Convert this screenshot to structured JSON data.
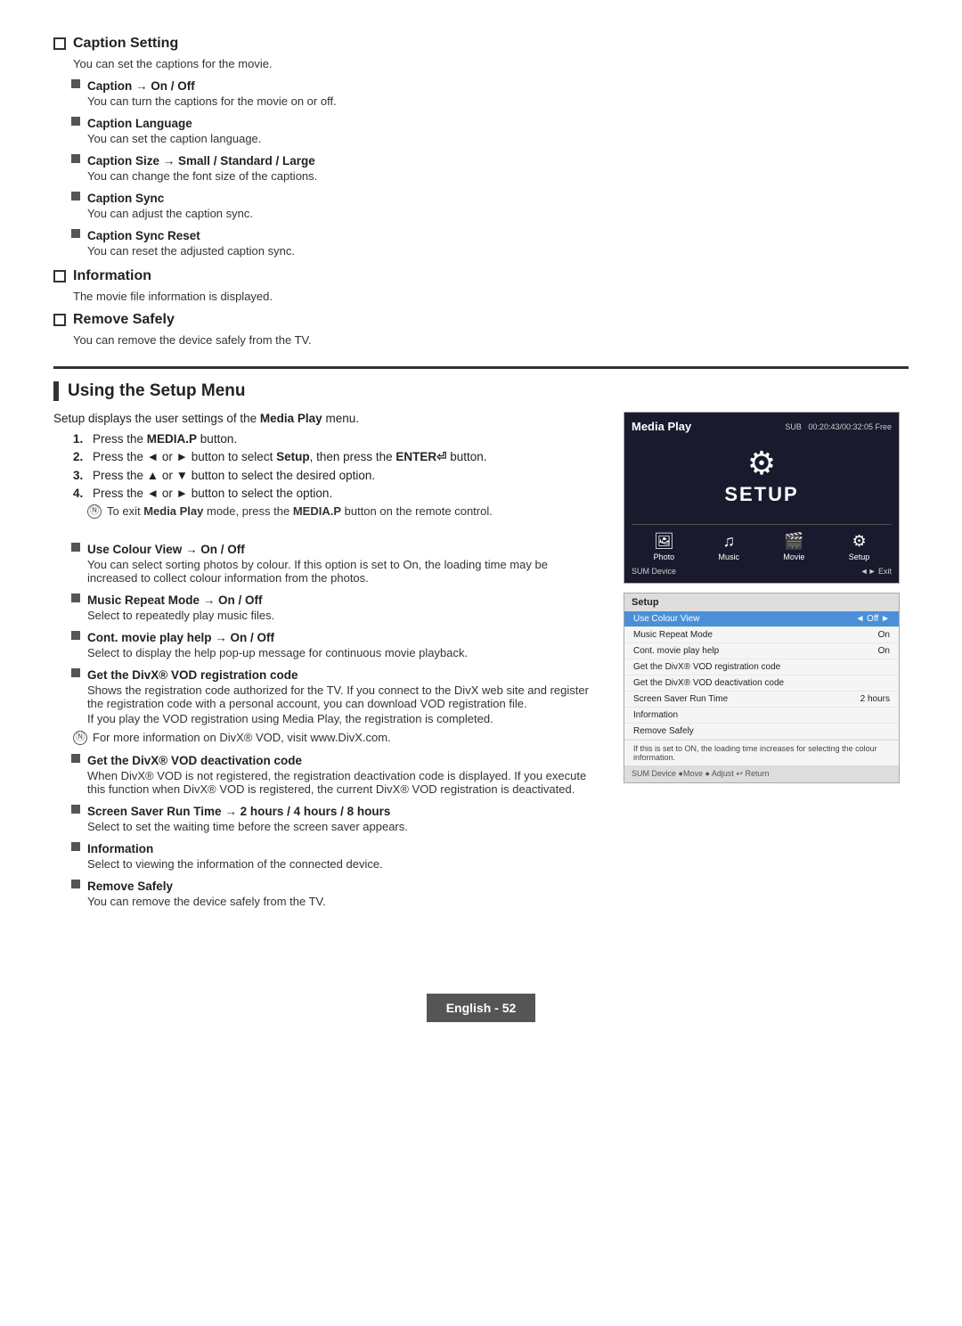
{
  "page": {
    "footer_label": "English - 52"
  },
  "caption_setting": {
    "heading": "Caption Setting",
    "description": "You can set the captions for the movie.",
    "items": [
      {
        "label": "Caption → On / Off",
        "description": "You can turn the captions for the movie on or off."
      },
      {
        "label": "Caption Language",
        "description": "You can set the caption language."
      },
      {
        "label": "Caption Size → Small / Standard / Large",
        "description": "You can change the font size of the captions."
      },
      {
        "label": "Caption Sync",
        "description": "You can adjust the caption sync."
      },
      {
        "label": "Caption Sync Reset",
        "description": "You can reset the adjusted caption sync."
      }
    ]
  },
  "information": {
    "heading": "Information",
    "description": "The movie file information is displayed."
  },
  "remove_safely": {
    "heading": "Remove Safely",
    "description": "You can remove the device safely from the TV."
  },
  "using_setup": {
    "title": "Using the Setup Menu",
    "intro": "Setup displays the user settings of the",
    "intro_bold": "Media Play",
    "intro_end": "menu.",
    "steps": [
      {
        "num": "1.",
        "text_pre": "Press the ",
        "text_bold": "MEDIA.P",
        "text_post": " button."
      },
      {
        "num": "2.",
        "text_pre": "Press the ◄ or ► button to select ",
        "text_bold": "Setup",
        "text_mid": ", then press the ",
        "text_bold2": "ENTER",
        "text_post": " button."
      },
      {
        "num": "3.",
        "text_pre": "Press the ▲ or ▼ button to select the desired option."
      },
      {
        "num": "4.",
        "text_pre": "Press the ◄ or ► button to select the option."
      }
    ],
    "note": "To exit Media Play mode, press the MEDIA.P button on the remote control.",
    "sub_items": [
      {
        "label": "Use Colour View → On / Off",
        "description": "You can select sorting photos by colour. If this option is set to On, the loading time may be increased to collect colour information from the photos."
      },
      {
        "label": "Music Repeat Mode → On / Off",
        "description": "Select to repeatedly play music files."
      },
      {
        "label": "Cont. movie play help → On / Off",
        "description": "Select to display the help pop-up message for continuous movie playback."
      },
      {
        "label": "Get the DivX® VOD registration code",
        "description": "Shows the registration code authorized for the TV. If you connect to the DivX web site and register the registration code with a personal account, you can download VOD registration file.",
        "extra": "If you play the VOD registration using Media Play, the registration is completed.",
        "note": "For more information on DivX® VOD, visit www.DivX.com."
      },
      {
        "label": "Get the DivX® VOD deactivation code",
        "description": "When DivX® VOD is not registered, the registration deactivation code is displayed. If you execute this function when DivX® VOD is registered, the current DivX® VOD registration is deactivated."
      },
      {
        "label": "Screen Saver Run Time → 2 hours / 4 hours / 8 hours",
        "description": "Select to set the waiting time before the screen saver appears."
      },
      {
        "label": "Information",
        "description": "Select to viewing the information of the connected device."
      },
      {
        "label": "Remove Safely",
        "description": "You can remove the device safely from the TV."
      }
    ]
  },
  "media_play_ui": {
    "title": "Media Play",
    "channel": "SUB",
    "time": "00:20:43/00:32:05 Free",
    "setup_label": "SETUP",
    "icons": [
      {
        "symbol": "🖼",
        "label": "Photo"
      },
      {
        "symbol": "♪",
        "label": "Music"
      },
      {
        "symbol": "🎬",
        "label": "Movie"
      },
      {
        "symbol": "⚙",
        "label": "Setup"
      }
    ],
    "footer_left": "SUM  Device",
    "footer_right": "◄► Exit"
  },
  "setup_menu_ui": {
    "header": "Setup",
    "rows": [
      {
        "label": "Use Colour View",
        "value": "◄  Off  ►",
        "highlighted": true
      },
      {
        "label": "Music Repeat Mode",
        "value": "On",
        "highlighted": false
      },
      {
        "label": "Cont. movie play help",
        "value": "On",
        "highlighted": false
      },
      {
        "label": "Get the DivX® VOD registration code",
        "value": "",
        "highlighted": false
      },
      {
        "label": "Get the DivX® VOD deactivation code",
        "value": "",
        "highlighted": false
      },
      {
        "label": "Screen Saver Run Time",
        "value": "2 hours",
        "highlighted": false
      },
      {
        "label": "Information",
        "value": "",
        "highlighted": false
      },
      {
        "label": "Remove Safely",
        "value": "",
        "highlighted": false
      }
    ],
    "note": "If this is set to ON, the loading time increases for selecting the colour information.",
    "footer": "SUM  Device  ●Move  ● Adjust  ↩ Return"
  }
}
